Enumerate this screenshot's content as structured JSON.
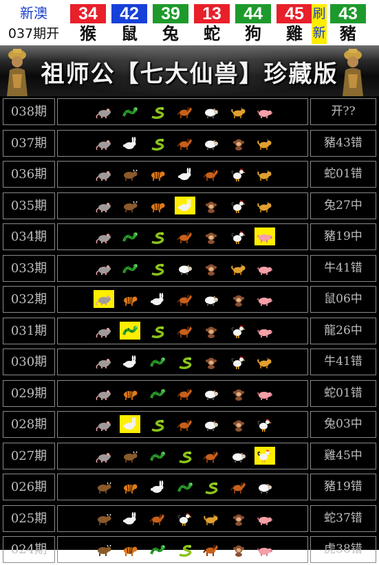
{
  "header": {
    "brand": "新澳",
    "latest_issue": "037期开",
    "refresh_label": "刷新",
    "balls": [
      {
        "number": "34",
        "zodiac": "猴",
        "color": "#e8202a"
      },
      {
        "number": "42",
        "zodiac": "鼠",
        "color": "#1740d8"
      },
      {
        "number": "39",
        "zodiac": "兔",
        "color": "#1e9a2c"
      },
      {
        "number": "13",
        "zodiac": "蛇",
        "color": "#e8202a"
      },
      {
        "number": "44",
        "zodiac": "狗",
        "color": "#1e9a2c"
      },
      {
        "number": "45",
        "zodiac": "雞",
        "color": "#e8202a"
      },
      {
        "number": "43",
        "zodiac": "豬",
        "color": "#1e9a2c"
      }
    ]
  },
  "banner": {
    "title": "祖师公【七大仙兽】珍藏版"
  },
  "rows": [
    {
      "issue": "038期",
      "result": "开??",
      "icons": [
        "rat",
        "dragon",
        "snake",
        "horse",
        "sheep",
        "dog",
        "pig"
      ],
      "highlight": -1
    },
    {
      "issue": "037期",
      "result": "豬43错",
      "icons": [
        "rat",
        "rabbit",
        "snake",
        "horse",
        "sheep",
        "monkey",
        "dog"
      ],
      "highlight": -1
    },
    {
      "issue": "036期",
      "result": "蛇01错",
      "icons": [
        "rat",
        "ox",
        "tiger",
        "rabbit",
        "horse",
        "rooster",
        "dog"
      ],
      "highlight": -1
    },
    {
      "issue": "035期",
      "result": "兔27中",
      "icons": [
        "rat",
        "ox",
        "tiger",
        "rabbit",
        "monkey",
        "rooster",
        "dog"
      ],
      "highlight": 3
    },
    {
      "issue": "034期",
      "result": "豬19中",
      "icons": [
        "rat",
        "dragon",
        "snake",
        "horse",
        "monkey",
        "rooster",
        "pig"
      ],
      "highlight": 6
    },
    {
      "issue": "033期",
      "result": "牛41错",
      "icons": [
        "rat",
        "dragon",
        "snake",
        "sheep",
        "monkey",
        "dog",
        "pig"
      ],
      "highlight": -1
    },
    {
      "issue": "032期",
      "result": "鼠06中",
      "icons": [
        "rat",
        "tiger",
        "rabbit",
        "horse",
        "sheep",
        "monkey",
        "pig"
      ],
      "highlight": 0
    },
    {
      "issue": "031期",
      "result": "龍26中",
      "icons": [
        "rat",
        "dragon",
        "snake",
        "horse",
        "monkey",
        "rooster",
        "pig"
      ],
      "highlight": 1
    },
    {
      "issue": "030期",
      "result": "牛41错",
      "icons": [
        "rat",
        "rabbit",
        "dragon",
        "snake",
        "monkey",
        "rooster",
        "dog"
      ],
      "highlight": -1
    },
    {
      "issue": "029期",
      "result": "蛇01错",
      "icons": [
        "rat",
        "tiger",
        "dragon",
        "horse",
        "sheep",
        "monkey",
        "pig"
      ],
      "highlight": -1
    },
    {
      "issue": "028期",
      "result": "兔03中",
      "icons": [
        "rat",
        "rabbit",
        "snake",
        "horse",
        "sheep",
        "monkey",
        "rooster"
      ],
      "highlight": 1
    },
    {
      "issue": "027期",
      "result": "雞45中",
      "icons": [
        "rat",
        "ox",
        "dragon",
        "snake",
        "horse",
        "sheep",
        "rooster"
      ],
      "highlight": 6
    },
    {
      "issue": "026期",
      "result": "豬19错",
      "icons": [
        "ox",
        "tiger",
        "rabbit",
        "dragon",
        "snake",
        "horse",
        "sheep"
      ],
      "highlight": -1
    },
    {
      "issue": "025期",
      "result": "蛇37错",
      "icons": [
        "ox",
        "rabbit",
        "horse",
        "rooster",
        "dog",
        "monkey",
        "pig"
      ],
      "highlight": -1
    },
    {
      "issue": "024期",
      "result": "虎38错",
      "icons": [
        "ox",
        "tiger",
        "dragon",
        "snake",
        "horse",
        "monkey",
        "pig"
      ],
      "highlight": -1
    }
  ],
  "icon_names": [
    "rat",
    "ox",
    "tiger",
    "rabbit",
    "dragon",
    "snake",
    "horse",
    "sheep",
    "monkey",
    "rooster",
    "dog",
    "pig"
  ]
}
